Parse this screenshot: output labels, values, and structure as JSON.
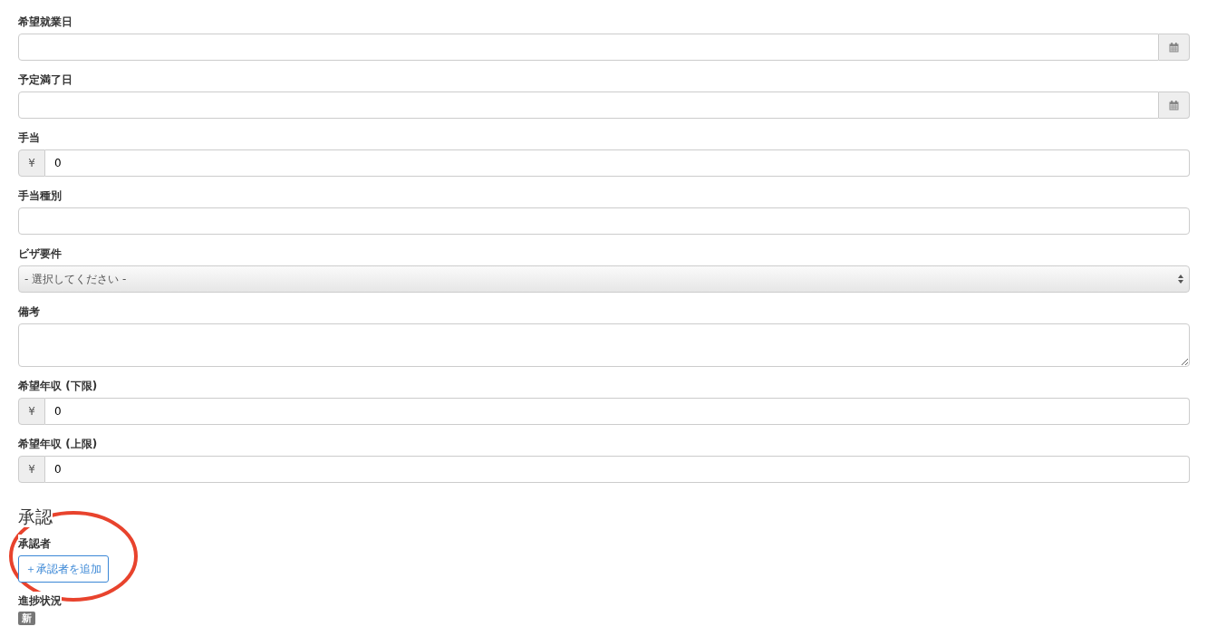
{
  "fields": [
    {
      "label": "希望就業日",
      "kind": "date"
    },
    {
      "label": "予定満了日",
      "kind": "date"
    },
    {
      "label": "手当",
      "kind": "currency",
      "prefix": "¥",
      "value": "0"
    },
    {
      "label": "手当種別",
      "kind": "text"
    },
    {
      "label": "ビザ要件",
      "kind": "select",
      "value": "- 選択してください -"
    },
    {
      "label": "備考",
      "kind": "textarea"
    },
    {
      "label": "希望年収 (下限)",
      "kind": "currency",
      "prefix": "¥",
      "value": "0"
    },
    {
      "label": "希望年収 (上限)",
      "kind": "currency",
      "prefix": "¥",
      "value": "0"
    }
  ],
  "approval": {
    "heading": "承認",
    "approver_label": "承認者",
    "add_button": "＋承認者を追加",
    "status_label": "進捗状況",
    "status_badge": "新"
  },
  "annotation": {
    "kind": "ellipse",
    "color": "#e8432d"
  }
}
